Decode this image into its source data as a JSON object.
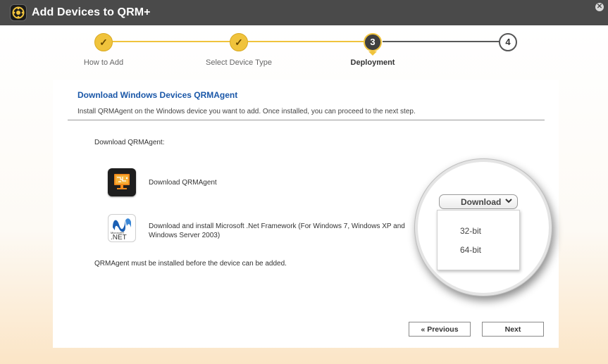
{
  "window": {
    "title": "Add Devices to QRM+"
  },
  "stepper": {
    "steps": [
      {
        "number": "1",
        "label": "How to Add",
        "state": "done",
        "mark": "✓"
      },
      {
        "number": "2",
        "label": "Select Device Type",
        "state": "done",
        "mark": "✓"
      },
      {
        "number": "3",
        "label": "Deployment",
        "state": "current",
        "mark": "3"
      },
      {
        "number": "4",
        "label": "",
        "state": "todo",
        "mark": "4"
      }
    ]
  },
  "content": {
    "title": "Download Windows Devices QRMAgent",
    "description": "Install QRMAgent on the Windows device you want to add. Once installed, you can proceed to the next step.",
    "download_label": "Download QRMAgent:",
    "items": [
      {
        "icon": "qrmagent-icon",
        "text": "Download QRMAgent"
      },
      {
        "icon": "dotnet-icon",
        "text": "Download and install Microsoft .Net Framework (For Windows 7, Windows XP and Windows Server 2003)",
        "icon_caption_small": "Microsoft®",
        "icon_caption": ".NET"
      }
    ],
    "note": "QRMAgent must be installed before the device can be added."
  },
  "download_dropdown": {
    "label": "Download",
    "options": [
      "32-bit",
      "64-bit"
    ]
  },
  "buttons": {
    "previous": "« Previous",
    "next": "Next"
  },
  "colors": {
    "accent": "#f0c33c",
    "title_blue": "#1a57a8",
    "titlebar": "#4a4a4a"
  }
}
